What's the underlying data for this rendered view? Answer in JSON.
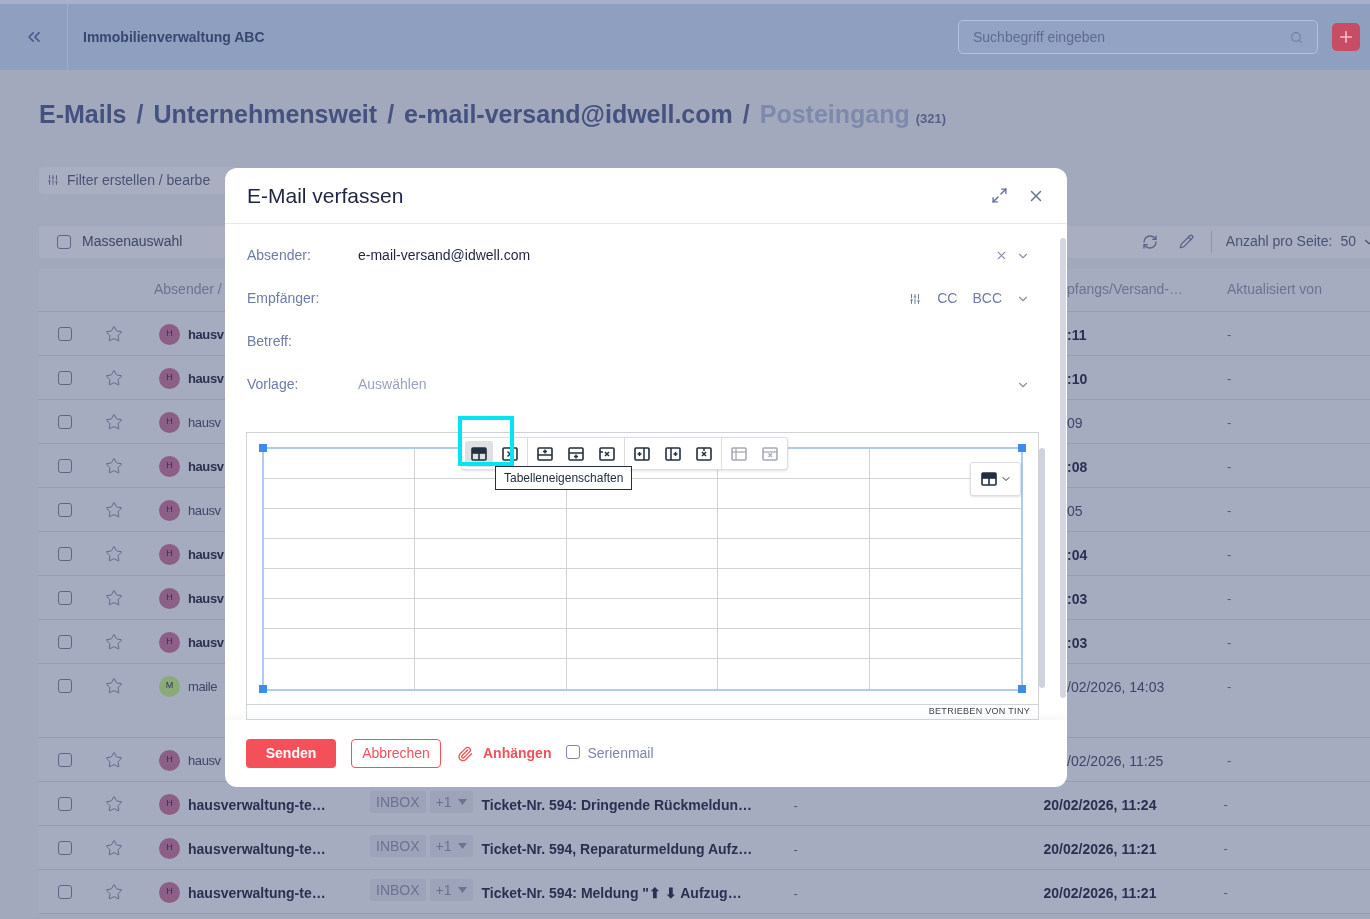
{
  "app_bar": {
    "title": "Immobilienverwaltung ABC",
    "search": {
      "placeholder": "Suchbegriff eingeben"
    }
  },
  "breadcrumb": {
    "separator": "/",
    "items": [
      {
        "label": "E-Mails",
        "current": false
      },
      {
        "label": "Unternehmensweit",
        "current": false
      },
      {
        "label": "e-mail-versand@idwell.com",
        "current": false
      },
      {
        "label": "Posteingang",
        "current": true,
        "count": "(321)"
      }
    ]
  },
  "filter_button": "Filter erstellen / bearbe",
  "toolbar": {
    "bulk_select": {
      "label": "Massenauswahl",
      "checked": false
    },
    "per_page_label": "Anzahl pro Seite:",
    "per_page_value": "50"
  },
  "table": {
    "columns": [
      "Absender /",
      "pfangs/Versand-…",
      "Aktualisiert von"
    ],
    "rows": [
      {
        "kind": "clipped",
        "checked": false,
        "starred": false,
        "avatar": "H",
        "color": "#8c5f86",
        "sender": "hausv",
        "unread": true,
        "date": ":11",
        "updated_by": "-"
      },
      {
        "kind": "clipped",
        "checked": false,
        "starred": false,
        "avatar": "H",
        "color": "#8c5f86",
        "sender": "hausv",
        "unread": true,
        "date": ":10",
        "updated_by": "-"
      },
      {
        "kind": "clipped",
        "checked": false,
        "starred": false,
        "avatar": "H",
        "color": "#8c5f86",
        "sender": "hausv",
        "unread": false,
        "date": "09",
        "updated_by": "-"
      },
      {
        "kind": "clipped",
        "checked": false,
        "starred": false,
        "avatar": "H",
        "color": "#8c5f86",
        "sender": "hausv",
        "unread": true,
        "date": ":08",
        "updated_by": "-"
      },
      {
        "kind": "clipped",
        "checked": false,
        "starred": false,
        "avatar": "H",
        "color": "#8c5f86",
        "sender": "hausv",
        "unread": false,
        "date": "05",
        "updated_by": "-"
      },
      {
        "kind": "clipped",
        "checked": false,
        "starred": false,
        "avatar": "H",
        "color": "#8c5f86",
        "sender": "hausv",
        "unread": true,
        "date": ":04",
        "updated_by": "-"
      },
      {
        "kind": "clipped",
        "checked": false,
        "starred": false,
        "avatar": "H",
        "color": "#8c5f86",
        "sender": "hausv",
        "unread": true,
        "date": ":03",
        "updated_by": "-"
      },
      {
        "kind": "clipped",
        "checked": false,
        "starred": false,
        "avatar": "H",
        "color": "#8c5f86",
        "sender": "hausv",
        "unread": true,
        "date": ":03",
        "updated_by": "-"
      },
      {
        "kind": "clipped-tall",
        "checked": false,
        "starred": false,
        "avatar": "M",
        "color": "#8aab78",
        "sender": "maile",
        "unread": false,
        "date": "/02/2026, 14:03",
        "updated_by": "-"
      },
      {
        "kind": "clipped",
        "checked": false,
        "starred": false,
        "avatar": "H",
        "color": "#8c5f86",
        "sender": "hausv",
        "unread": false,
        "date": "/02/2026, 11:25",
        "updated_by": "-"
      },
      {
        "kind": "full",
        "checked": false,
        "starred": false,
        "avatar": "H",
        "color": "#8c5f86",
        "sender": "hausverwaltung-te…",
        "unread": true,
        "folder": "INBOX",
        "extra": "+1",
        "subject": "Ticket-Nr. 594: Dringende Rückmeldun…",
        "column_4": "-",
        "date": "20/02/2026, 11:24",
        "updated_by": "-"
      },
      {
        "kind": "full",
        "checked": false,
        "starred": false,
        "avatar": "H",
        "color": "#8c5f86",
        "sender": "hausverwaltung-te…",
        "unread": true,
        "folder": "INBOX",
        "extra": "+1",
        "subject": "Ticket-Nr. 594, Reparaturmeldung Aufz…",
        "column_4": "-",
        "date": "20/02/2026, 11:21",
        "updated_by": "-"
      },
      {
        "kind": "full",
        "checked": false,
        "starred": false,
        "avatar": "H",
        "color": "#8c5f86",
        "sender": "hausverwaltung-te…",
        "unread": true,
        "folder": "INBOX",
        "extra": "+1",
        "subject": "Ticket-Nr. 594: Meldung \"⬆ ⬇ Aufzug…",
        "column_4": "-",
        "date": "20/02/2026, 11:21",
        "updated_by": "-"
      }
    ]
  },
  "dialog": {
    "title": "E-Mail verfassen",
    "fields": [
      {
        "kind": "select",
        "label": "Absender:",
        "value": "e-mail-versand@idwell.com"
      },
      {
        "kind": "recipients",
        "label": "Empfänger:",
        "cc": "CC",
        "bcc": "BCC"
      },
      {
        "kind": "text",
        "label": "Betreff:"
      },
      {
        "kind": "select",
        "label": "Vorlage:",
        "placeholder": "Auswählen"
      }
    ],
    "table_toolbar": {
      "groups": [
        [
          {
            "kind": "table-props",
            "selected": true,
            "disabled": false
          },
          {
            "kind": "delete-table",
            "selected": false,
            "disabled": false
          }
        ],
        [
          {
            "kind": "row-above",
            "selected": false,
            "disabled": false
          },
          {
            "kind": "row-below",
            "selected": false,
            "disabled": false
          },
          {
            "kind": "delete-row",
            "selected": false,
            "disabled": false
          }
        ],
        [
          {
            "kind": "col-before",
            "selected": false,
            "disabled": false
          },
          {
            "kind": "col-after",
            "selected": false,
            "disabled": false
          },
          {
            "kind": "delete-col",
            "selected": false,
            "disabled": false
          }
        ],
        [
          {
            "kind": "cell-props",
            "selected": false,
            "disabled": true
          },
          {
            "kind": "delete-cell",
            "selected": false,
            "disabled": true
          }
        ]
      ],
      "tooltip": "Tabelleneigenschaften"
    },
    "powered_by": "BETRIEBEN VON TINY",
    "actions": {
      "send": "Senden",
      "cancel": "Abbrechen",
      "attach": "Anhängen",
      "serial": {
        "label": "Serienmail",
        "checked": false
      }
    }
  }
}
